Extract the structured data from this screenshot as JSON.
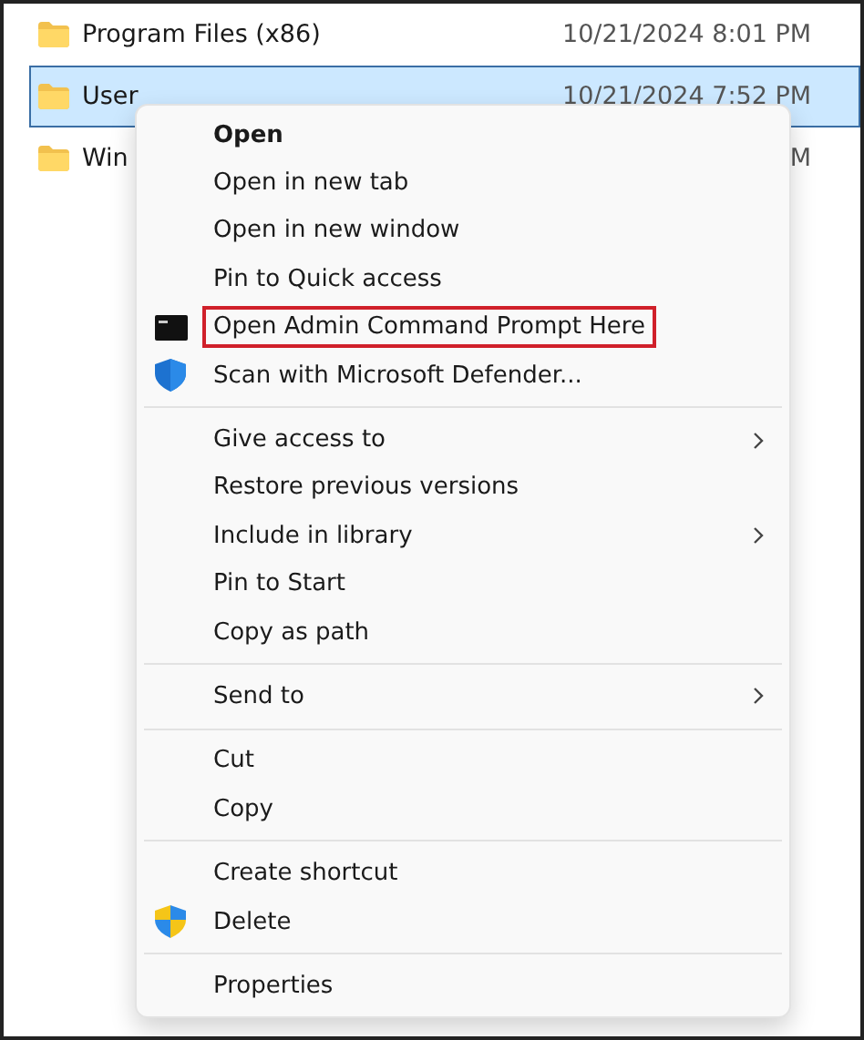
{
  "files": [
    {
      "name": "Program Files (x86)",
      "modified": "10/21/2024 8:01 PM",
      "selected": false
    },
    {
      "name": "User",
      "modified": "10/21/2024 7:52 PM",
      "selected": true
    },
    {
      "name": "Win",
      "modified": "M",
      "selected": false
    }
  ],
  "context_menu": {
    "groups": [
      [
        {
          "label": "Open",
          "kind": "plain",
          "default": true,
          "submenu": false,
          "highlighted": false
        },
        {
          "label": "Open in new tab",
          "kind": "plain",
          "default": false,
          "submenu": false,
          "highlighted": false
        },
        {
          "label": "Open in new window",
          "kind": "plain",
          "default": false,
          "submenu": false,
          "highlighted": false
        },
        {
          "label": "Pin to Quick access",
          "kind": "plain",
          "default": false,
          "submenu": false,
          "highlighted": false
        },
        {
          "label": "Open Admin Command Prompt Here",
          "kind": "terminal",
          "default": false,
          "submenu": false,
          "highlighted": true
        },
        {
          "label": "Scan with Microsoft Defender...",
          "kind": "defender",
          "default": false,
          "submenu": false,
          "highlighted": false
        }
      ],
      [
        {
          "label": "Give access to",
          "kind": "plain",
          "default": false,
          "submenu": true,
          "highlighted": false
        },
        {
          "label": "Restore previous versions",
          "kind": "plain",
          "default": false,
          "submenu": false,
          "highlighted": false
        },
        {
          "label": "Include in library",
          "kind": "plain",
          "default": false,
          "submenu": true,
          "highlighted": false
        },
        {
          "label": "Pin to Start",
          "kind": "plain",
          "default": false,
          "submenu": false,
          "highlighted": false
        },
        {
          "label": "Copy as path",
          "kind": "plain",
          "default": false,
          "submenu": false,
          "highlighted": false
        }
      ],
      [
        {
          "label": "Send to",
          "kind": "plain",
          "default": false,
          "submenu": true,
          "highlighted": false
        }
      ],
      [
        {
          "label": "Cut",
          "kind": "plain",
          "default": false,
          "submenu": false,
          "highlighted": false
        },
        {
          "label": "Copy",
          "kind": "plain",
          "default": false,
          "submenu": false,
          "highlighted": false
        }
      ],
      [
        {
          "label": "Create shortcut",
          "kind": "plain",
          "default": false,
          "submenu": false,
          "highlighted": false
        },
        {
          "label": "Delete",
          "kind": "uac",
          "default": false,
          "submenu": false,
          "highlighted": false
        }
      ],
      [
        {
          "label": "Properties",
          "kind": "plain",
          "default": false,
          "submenu": false,
          "highlighted": false
        }
      ]
    ]
  }
}
